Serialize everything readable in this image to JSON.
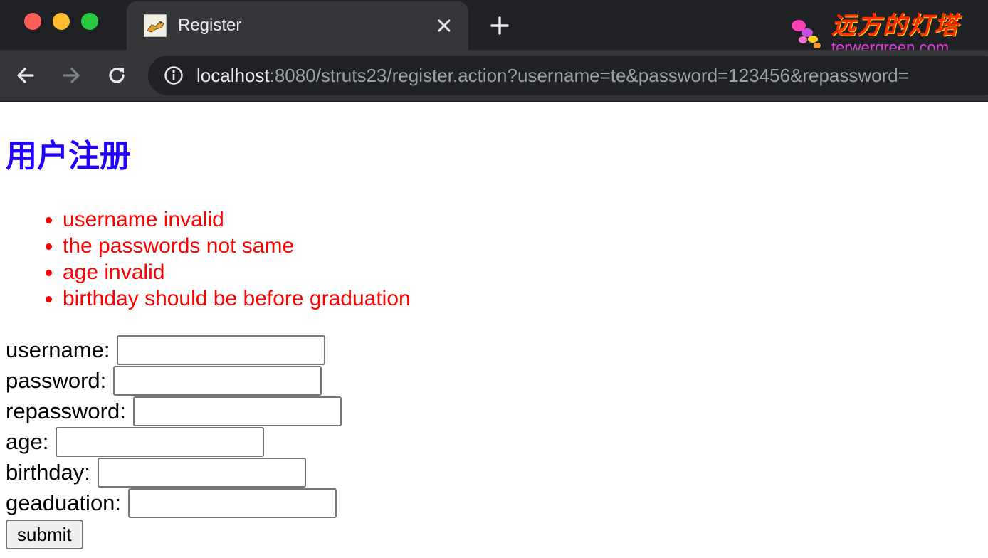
{
  "browser": {
    "tab": {
      "title": "Register",
      "favicon": "tomcat-icon"
    },
    "address_bar": {
      "host": "localhost",
      "rest": ":8080/struts23/register.action?username=te&password=123456&repassword="
    },
    "icons": {
      "back": "arrow-left-icon",
      "forward": "arrow-right-icon",
      "reload": "reload-icon",
      "info": "info-icon",
      "close": "close-icon",
      "new_tab": "plus-icon"
    },
    "traffic_lights": {
      "close": "#fe5f57",
      "minimize": "#febc2e",
      "maximize": "#28c840"
    }
  },
  "watermark": {
    "title": "远方的灯塔",
    "url": "terwergreen.com"
  },
  "page": {
    "title": "用户注册",
    "title_color": "#2200ff",
    "error_color": "#ff0000",
    "errors": [
      "username invalid",
      "the passwords not same",
      "age invalid",
      "birthday should be before graduation"
    ],
    "form": {
      "fields": [
        {
          "label": "username:",
          "value": ""
        },
        {
          "label": "password:",
          "value": ""
        },
        {
          "label": "repassword:",
          "value": ""
        },
        {
          "label": "age:",
          "value": ""
        },
        {
          "label": "birthday:",
          "value": ""
        },
        {
          "label": "geaduation:",
          "value": ""
        }
      ],
      "submit_label": "submit"
    }
  }
}
